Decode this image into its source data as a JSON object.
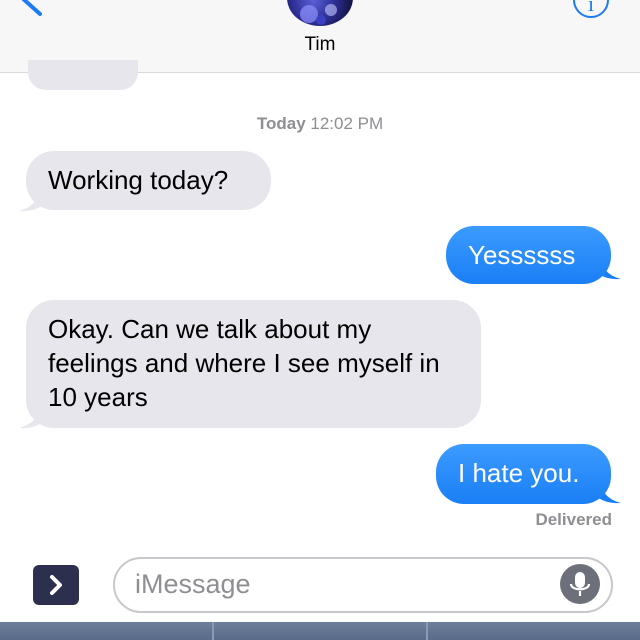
{
  "header": {
    "contact_name": "Tim",
    "info_glyph": "i",
    "icons": [
      "back-chevron-icon",
      "info-icon",
      "contact-avatar"
    ]
  },
  "conversation": {
    "timestamp_day": "Today",
    "timestamp_time": "12:02 PM",
    "messages": [
      {
        "direction": "incoming",
        "text": "Working today?"
      },
      {
        "direction": "outgoing",
        "text": "Yessssss"
      },
      {
        "direction": "incoming",
        "text": "Okay. Can we talk about my feelings and where I see myself in 10 years"
      },
      {
        "direction": "outgoing",
        "text": "I hate you."
      }
    ],
    "status": "Delivered"
  },
  "composer": {
    "placeholder": "iMessage",
    "icons": [
      "expand-chevron-icon",
      "microphone-icon"
    ]
  },
  "colors": {
    "outgoing_bubble": "#1a7ff5",
    "incoming_bubble": "#e6e6ec",
    "accent": "#1d7bf5",
    "secondary_text": "#8e8e93"
  }
}
